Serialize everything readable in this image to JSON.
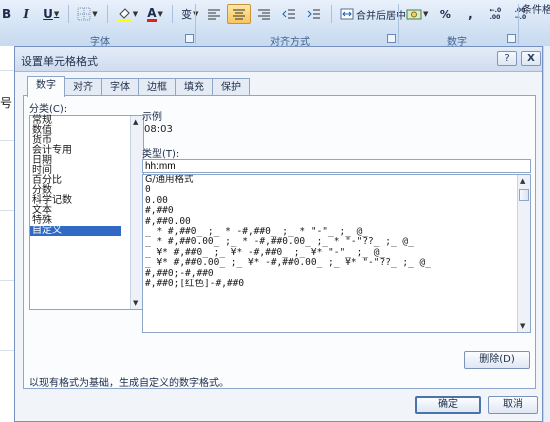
{
  "ribbon": {
    "bold": "B",
    "italic": "I",
    "underline": "U",
    "font_color_letter": "A",
    "pinyin": "变",
    "merge_center": "合并后居中",
    "percent": "%",
    "comma": ",",
    "inc_decimal": "←.0\n.00",
    "dec_decimal": ".00\n→.0",
    "conditional_format": "条件格",
    "group_font": "字体",
    "group_alignment": "对齐方式",
    "group_number": "数字"
  },
  "background": {
    "left_glyph": "号"
  },
  "dialog": {
    "title": "设置单元格格式",
    "help_btn": "?",
    "close_btn": "X",
    "tabs": [
      {
        "label": "数字"
      },
      {
        "label": "对齐"
      },
      {
        "label": "字体"
      },
      {
        "label": "边框"
      },
      {
        "label": "填充"
      },
      {
        "label": "保护"
      }
    ],
    "category_label": "分类(C):",
    "categories": [
      {
        "label": "常规",
        "selected": false
      },
      {
        "label": "数值",
        "selected": false
      },
      {
        "label": "货币",
        "selected": false
      },
      {
        "label": "会计专用",
        "selected": false
      },
      {
        "label": "日期",
        "selected": false
      },
      {
        "label": "时间",
        "selected": false
      },
      {
        "label": "百分比",
        "selected": false
      },
      {
        "label": "分数",
        "selected": false
      },
      {
        "label": "科学记数",
        "selected": false
      },
      {
        "label": "文本",
        "selected": false
      },
      {
        "label": "特殊",
        "selected": false
      },
      {
        "label": "自定义",
        "selected": true
      }
    ],
    "sample_label": "示例",
    "sample_value": "08:03",
    "type_label": "类型(T):",
    "type_value": "hh:mm",
    "formats": [
      "G/通用格式",
      "0",
      "0.00",
      "#,##0",
      "#,##0.00",
      "_ * #,##0_ ;_ * -#,##0_ ;_ * \"-\"_ ;_ @_",
      "_ * #,##0.00_ ;_ * -#,##0.00_ ;_ * \"-\"??_ ;_ @_",
      "_ ¥* #,##0_ ;_ ¥* -#,##0_ ;_ ¥* \"-\"_ ;_ @_",
      "_ ¥* #,##0.00_ ;_ ¥* -#,##0.00_ ;_ ¥* \"-\"??_ ;_ @_",
      "#,##0;-#,##0",
      "#,##0;[红色]-#,##0"
    ],
    "delete_btn": "删除(D)",
    "description": "以现有格式为基础，生成自定义的数字格式。",
    "ok_btn": "确定",
    "cancel_btn": "取消"
  }
}
